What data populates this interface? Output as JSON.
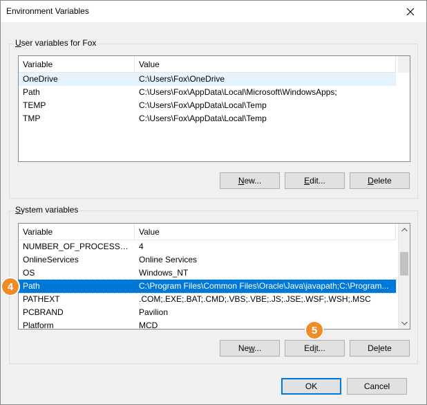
{
  "window": {
    "title": "Environment Variables",
    "close_icon": "close-icon"
  },
  "user_vars": {
    "group_label_mnemonic": "U",
    "group_label_rest": "ser variables for Fox",
    "columns": [
      "Variable",
      "Value"
    ],
    "rows": [
      {
        "variable": "OneDrive",
        "value": "C:\\Users\\Fox\\OneDrive"
      },
      {
        "variable": "Path",
        "value": "C:\\Users\\Fox\\AppData\\Local\\Microsoft\\WindowsApps;"
      },
      {
        "variable": "TEMP",
        "value": "C:\\Users\\Fox\\AppData\\Local\\Temp"
      },
      {
        "variable": "TMP",
        "value": "C:\\Users\\Fox\\AppData\\Local\\Temp"
      }
    ],
    "buttons": {
      "new_mn": "N",
      "new_rest": "ew...",
      "edit_mn": "E",
      "edit_rest": "dit...",
      "delete_mn": "D",
      "delete_rest": "elete"
    }
  },
  "system_vars": {
    "group_label_mnemonic": "S",
    "group_label_rest": "ystem variables",
    "columns": [
      "Variable",
      "Value"
    ],
    "rows": [
      {
        "variable": "NUMBER_OF_PROCESSORS",
        "value": "4"
      },
      {
        "variable": "OnlineServices",
        "value": "Online Services"
      },
      {
        "variable": "OS",
        "value": "Windows_NT"
      },
      {
        "variable": "Path",
        "value": "C:\\Program Files\\Common Files\\Oracle\\Java\\javapath;C:\\Program..."
      },
      {
        "variable": "PATHEXT",
        "value": ".COM;.EXE;.BAT;.CMD;.VBS;.VBE;.JS;.JSE;.WSF;.WSH;.MSC"
      },
      {
        "variable": "PCBRAND",
        "value": "Pavilion"
      },
      {
        "variable": "Platform",
        "value": "MCD"
      }
    ],
    "buttons": {
      "new_pre": "Ne",
      "new_mn": "w",
      "new_rest": "...",
      "edit_pre": "Ed",
      "edit_mn": "i",
      "edit_rest": "t...",
      "delete_pre": "De",
      "delete_mn": "l",
      "delete_rest": "ete"
    }
  },
  "footer": {
    "ok_label": "OK",
    "cancel_label": "Cancel"
  },
  "annotations": {
    "step4": "4",
    "step5": "5",
    "badge_color": "#f08c28"
  },
  "colors": {
    "selection": "#0078d7",
    "hover": "#e5f3ff"
  }
}
